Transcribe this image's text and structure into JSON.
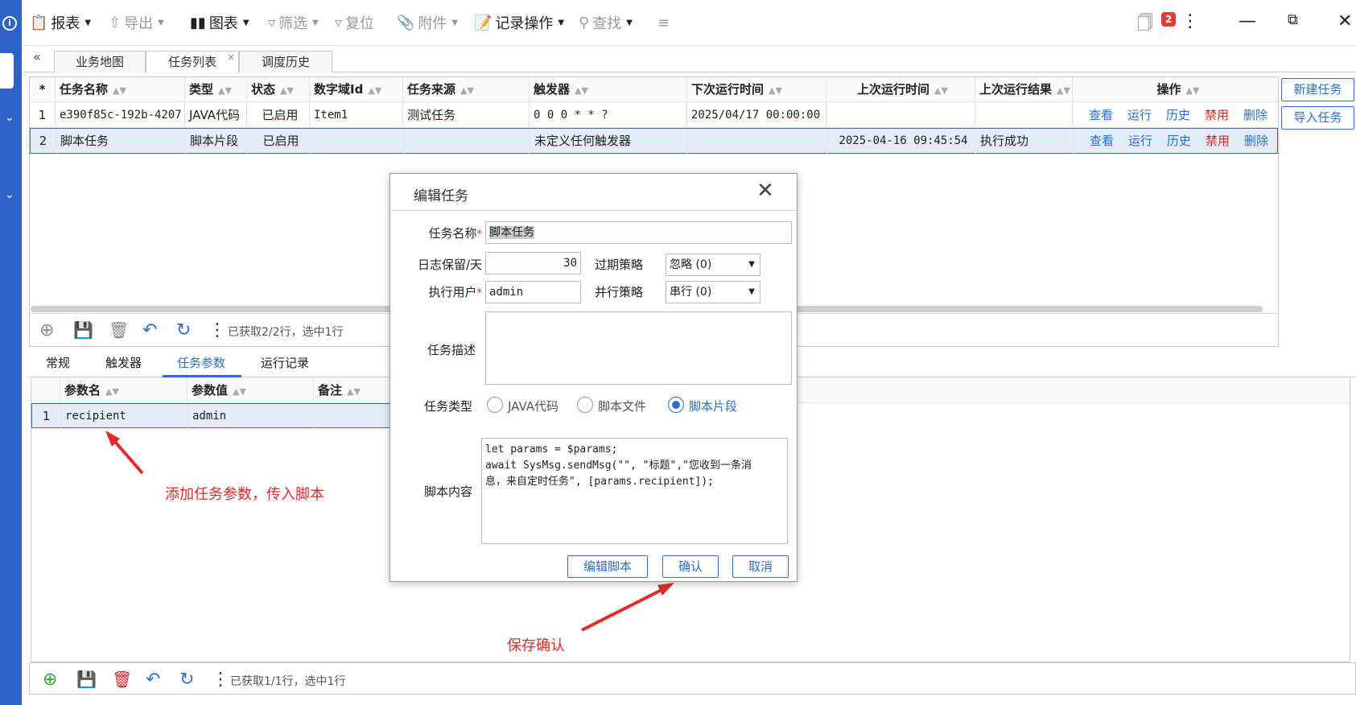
{
  "toolbar": {
    "report": "报表",
    "export": "导出",
    "chart": "图表",
    "filter": "筛选",
    "reset": "复位",
    "attach": "附件",
    "record_ops": "记录操作",
    "find": "查找",
    "badge_count": "2"
  },
  "tabs": [
    "业务地图",
    "任务列表",
    "调度历史"
  ],
  "grid1": {
    "headers": [
      "*",
      "任务名称",
      "类型",
      "状态",
      "数字域Id",
      "任务来源",
      "触发器",
      "下次运行时间",
      "上次运行时间",
      "上次运行结果",
      "操作"
    ],
    "rows": [
      {
        "num": "1",
        "name": "e390f85c-192b-4207",
        "type": "JAVA代码",
        "status": "已启用",
        "domain": "Item1",
        "source": "测试任务",
        "trigger": "0 0 0 * * ?",
        "next": "2025/04/17 00:00:00",
        "last": "",
        "result": ""
      },
      {
        "num": "2",
        "name": "脚本任务",
        "type": "脚本片段",
        "status": "已启用",
        "domain": "",
        "source": "",
        "trigger": "未定义任何触发器",
        "next": "",
        "last": "2025-04-16 09:45:54",
        "result": "执行成功"
      }
    ],
    "actions": [
      "查看",
      "运行",
      "历史",
      "禁用",
      "删除"
    ],
    "footer": "已获取2/2行，选中1行"
  },
  "right_buttons": {
    "new_task": "新建任务",
    "import_task": "导入任务"
  },
  "subtabs": [
    "常规",
    "触发器",
    "任务参数",
    "运行记录"
  ],
  "grid2": {
    "headers": [
      "参数名",
      "参数值",
      "备注"
    ],
    "rows": [
      {
        "num": "1",
        "name": "recipient",
        "value": "admin",
        "note": ""
      }
    ],
    "footer": "已获取1/1行，选中1行"
  },
  "annotations": {
    "param_note": "添加任务参数，传入脚本",
    "confirm_note": "保存确认"
  },
  "dialog": {
    "title": "编辑任务",
    "task_name_label": "任务名称",
    "task_name": "脚本任务",
    "log_days_label": "日志保留/天",
    "log_days": "30",
    "expire_label": "过期策略",
    "expire_value": "忽略 (0)",
    "user_label": "执行用户",
    "user_value": "admin",
    "parallel_label": "并行策略",
    "parallel_value": "串行 (0)",
    "desc_label": "任务描述",
    "type_label": "任务类型",
    "type_options": [
      "JAVA代码",
      "脚本文件",
      "脚本片段"
    ],
    "type_selected": "脚本片段",
    "script_label": "脚本内容",
    "script_lines": [
      "let params = $params;",
      "await SysMsg.sendMsg(\"\", \"标题\",\"您收到一条消",
      "息，来自定时任务\", [params.recipient]);"
    ],
    "buttons": {
      "edit_script": "编辑脚本",
      "confirm": "确认",
      "cancel": "取消"
    }
  },
  "colors": {
    "accent": "#2f6fc9",
    "danger": "#d42a2a",
    "annotation": "#e12a2a",
    "sidebar": "#2f63c8"
  }
}
